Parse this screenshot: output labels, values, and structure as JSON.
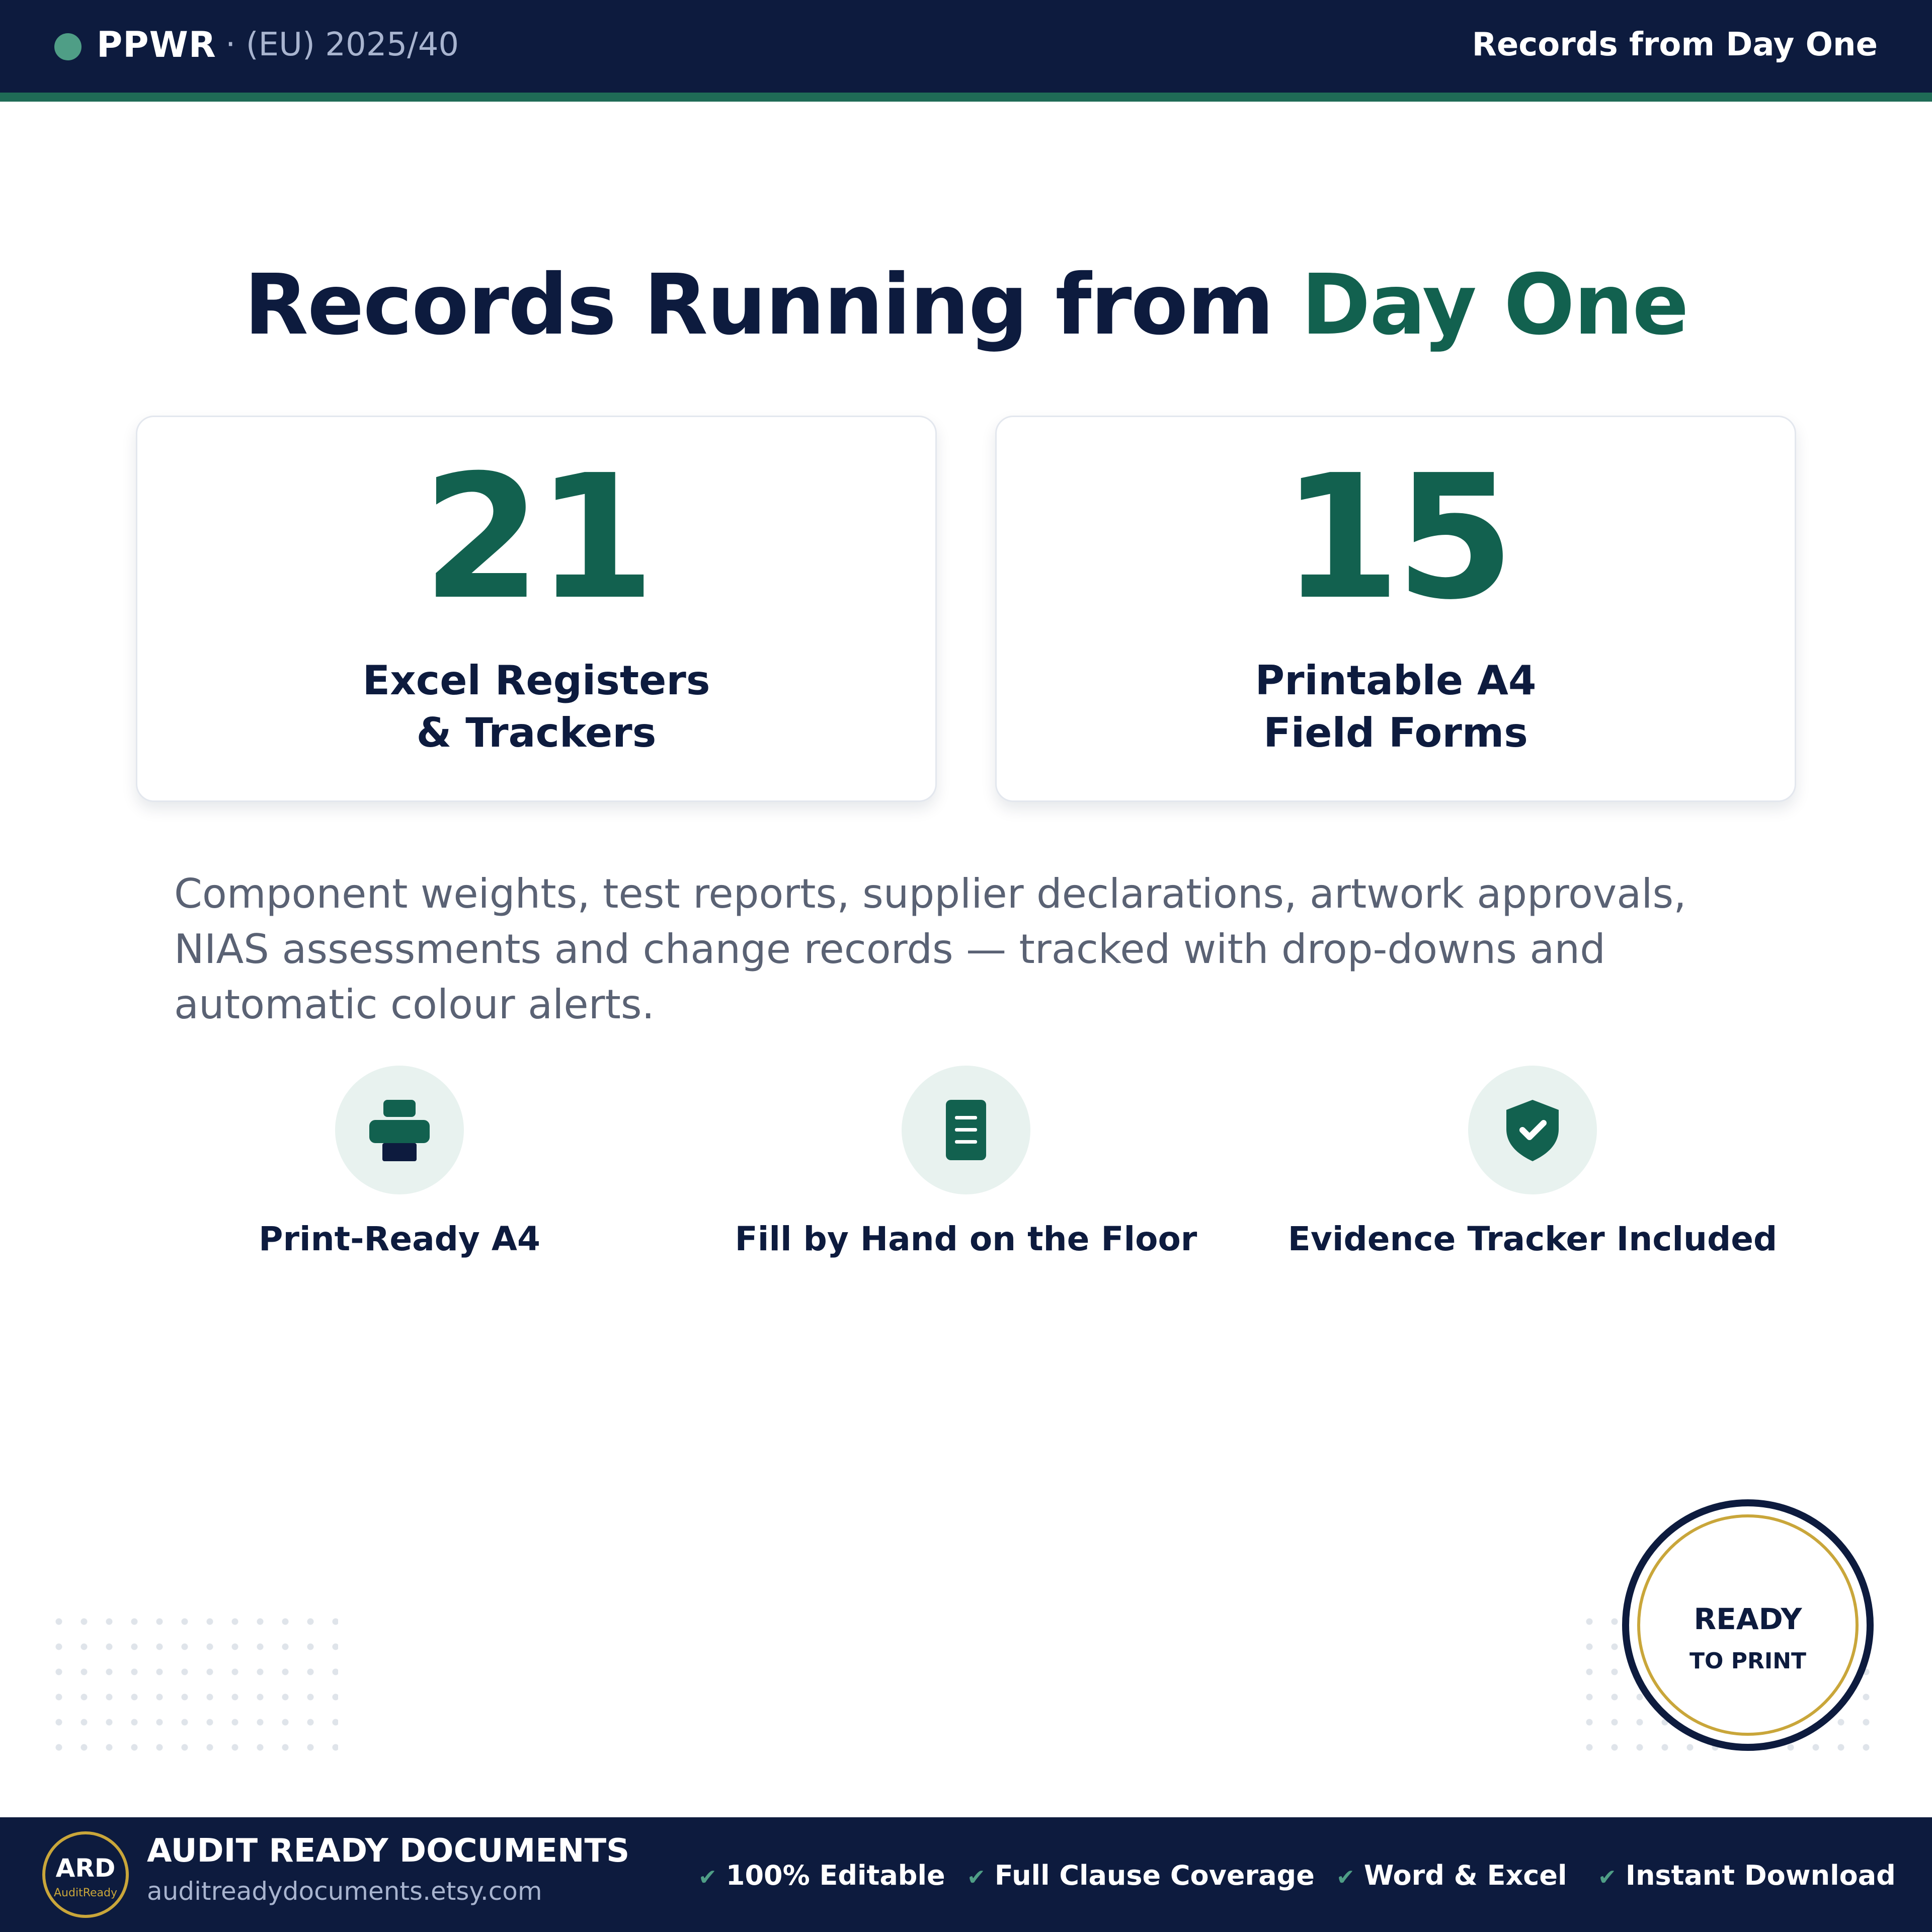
{
  "header": {
    "brand": "PPWR",
    "regulation": "· (EU) 2025/40",
    "tagline": "Records from Day One"
  },
  "headline": {
    "main": "Records Running from ",
    "accent": "Day One"
  },
  "stats": [
    {
      "number": "21",
      "label_line1": "Excel Registers",
      "label_line2": "& Trackers"
    },
    {
      "number": "15",
      "label_line1": "Printable A4",
      "label_line2": "Field Forms"
    }
  ],
  "description": "Component weights, test reports, supplier declarations, artwork approvals, NIAS assessments and change records — tracked with drop-downs and automatic colour alerts.",
  "features": [
    {
      "label": "Print-Ready A4",
      "icon": "printer-icon"
    },
    {
      "label": "Fill by Hand on the Floor",
      "icon": "document-icon"
    },
    {
      "label": "Evidence Tracker Included",
      "icon": "shield-check-icon"
    }
  ],
  "badge": {
    "line1": "READY",
    "line2": "TO PRINT"
  },
  "footer": {
    "logo_initials": "ARD",
    "logo_sub": "AuditReady",
    "company": "AUDIT READY DOCUMENTS",
    "url": "auditreadydocuments.etsy.com",
    "chips": [
      "100% Editable",
      "Full Clause Coverage",
      "Word & Excel",
      "Instant Download"
    ]
  },
  "colors": {
    "navy": "#0d1b3e",
    "green": "#12614f",
    "accent_green": "#4f9e86",
    "gold": "#c9a63a"
  }
}
